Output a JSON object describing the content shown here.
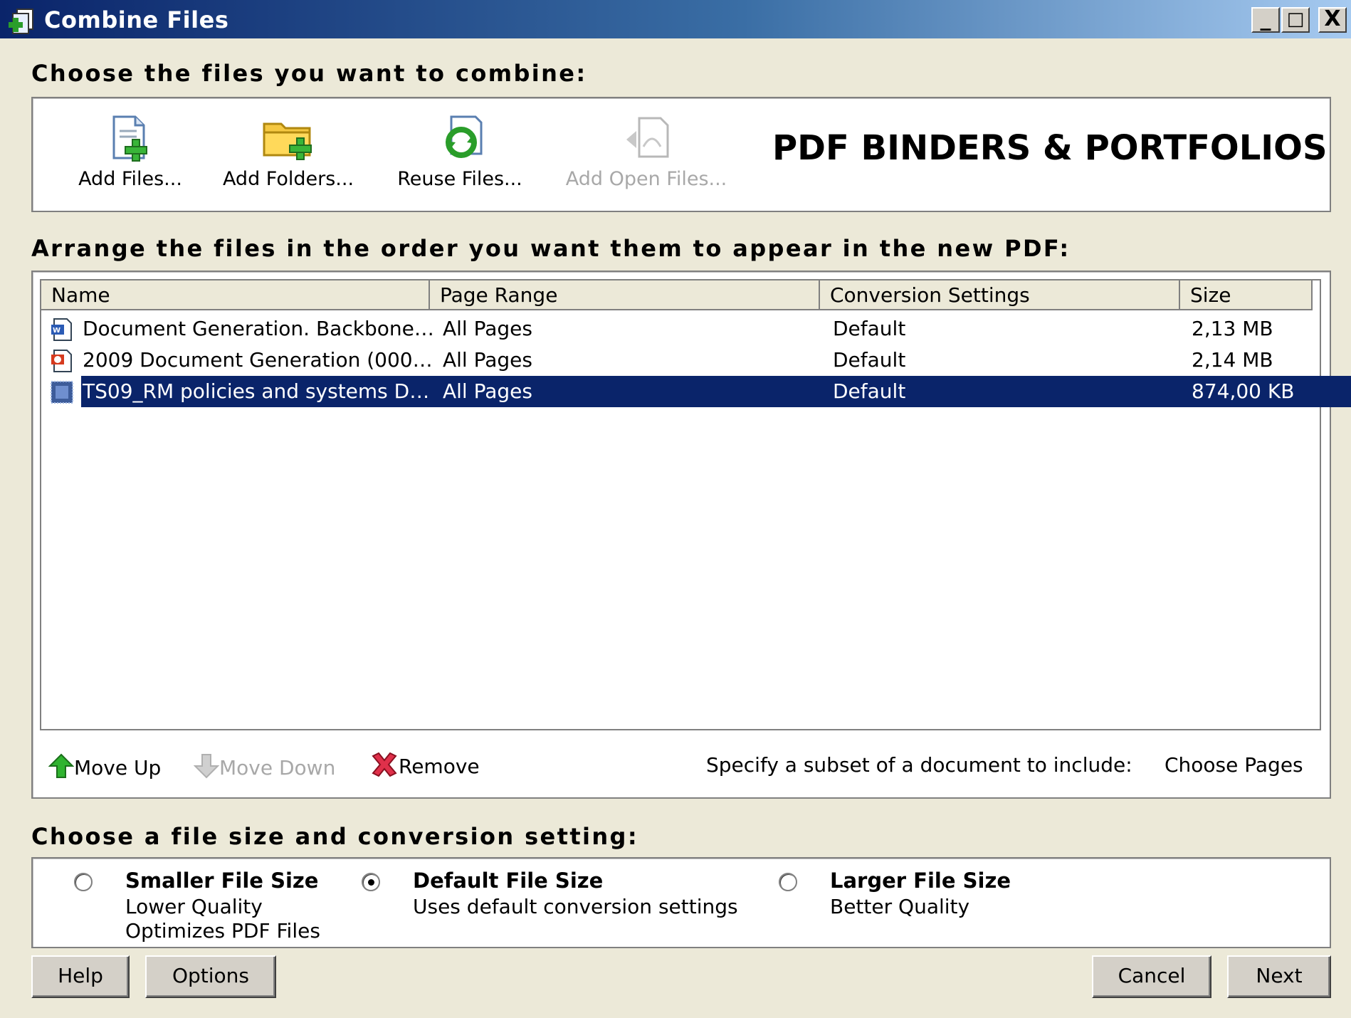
{
  "window": {
    "title": "Combine Files",
    "controls": [
      "_",
      "□",
      "X"
    ]
  },
  "section1": {
    "heading": "Choose the files you want to combine:",
    "tools": [
      {
        "label": "Add Files...",
        "icon": "add-file-icon",
        "enabled": true
      },
      {
        "label": "Add Folders...",
        "icon": "add-folder-icon",
        "enabled": true
      },
      {
        "label": "Reuse Files...",
        "icon": "reuse-files-icon",
        "enabled": true
      },
      {
        "label": "Add Open Files...",
        "icon": "open-files-icon",
        "enabled": false
      }
    ],
    "overlay_text": "PDF BINDERS & PORTFOLIOS"
  },
  "section2": {
    "heading": "Arrange the files in the order you want them to appear in the new PDF:",
    "columns": [
      "Name",
      "Page Range",
      "Conversion Settings",
      "Size"
    ],
    "rows": [
      {
        "name": "Document Generation. Backbone…",
        "range": "All Pages",
        "conversion": "Default",
        "size": "2,13 MB",
        "icon": "word-doc-icon",
        "selected": false
      },
      {
        "name": "2009 Document Generation (000…",
        "range": "All Pages",
        "conversion": "Default",
        "size": "2,14 MB",
        "icon": "powerpoint-doc-icon",
        "selected": false
      },
      {
        "name": "TS09_RM policies and systems D…",
        "range": "All Pages",
        "conversion": "Default",
        "size": "874,00 KB",
        "icon": "generic-doc-icon",
        "selected": true
      }
    ],
    "footer": {
      "move_up": "Move Up",
      "move_down": "Move Down",
      "remove": "Remove",
      "subset_label": "Specify a subset of a document to include:",
      "choose_pages": "Choose Pages"
    }
  },
  "section3": {
    "heading": "Choose a file size and conversion setting:",
    "options": [
      {
        "title": "Smaller File Size",
        "desc1": "Lower Quality",
        "desc2": "Optimizes PDF Files",
        "checked": false
      },
      {
        "title": "Default File Size",
        "desc1": "Uses default conversion settings",
        "desc2": "",
        "checked": true
      },
      {
        "title": "Larger File Size",
        "desc1": "Better Quality",
        "desc2": "",
        "checked": false
      }
    ]
  },
  "buttons": {
    "help": "Help",
    "options": "Options",
    "cancel": "Cancel",
    "next": "Next"
  }
}
